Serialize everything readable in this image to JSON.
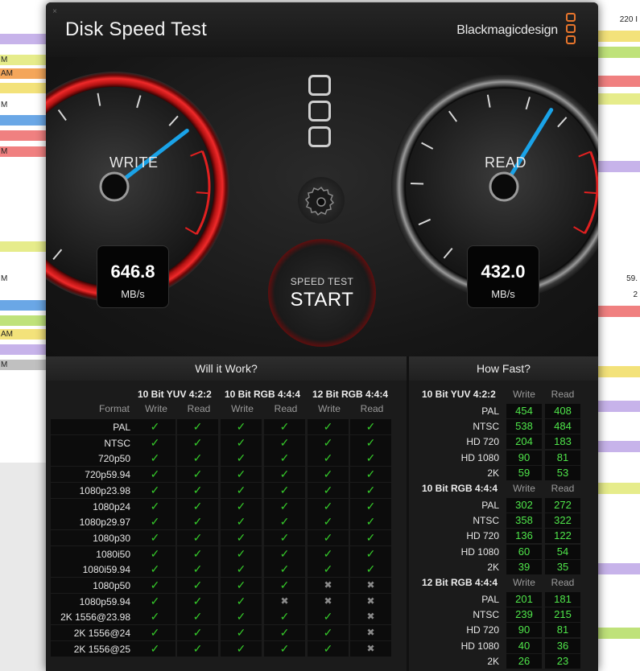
{
  "window": {
    "title": "Disk Speed Test",
    "brand": "Blackmagicdesign",
    "close_glyph": "×"
  },
  "background": {
    "left_fragments": [
      "M",
      "AM",
      "M",
      "M",
      "M",
      "AM",
      "M"
    ],
    "right_fragments": [
      "220 I",
      "59.",
      "2"
    ]
  },
  "gauges": {
    "write": {
      "label": "WRITE",
      "value": "646.8",
      "unit": "MB/s",
      "needle_fraction": 0.74
    },
    "read": {
      "label": "READ",
      "value": "432.0",
      "unit": "MB/s",
      "needle_fraction": 0.66
    }
  },
  "start_button": {
    "sub": "SPEED TEST",
    "main": "START"
  },
  "icons": {
    "settings": "gear-icon",
    "stack": "drive-stack-icon",
    "brand_logo": "blackmagic-logo-icon"
  },
  "colors": {
    "accent_red": "#d41b1b",
    "needle_blue": "#1aa3e8",
    "ok_green": "#35c92a",
    "value_green": "#4fe64a",
    "brand_orange": "#e8752c"
  },
  "will_it_work": {
    "header": "Will it Work?",
    "format_label": "Format",
    "groups": [
      "10 Bit YUV 4:2:2",
      "10 Bit RGB 4:4:4",
      "12 Bit RGB 4:4:4"
    ],
    "col_write": "Write",
    "col_read": "Read",
    "rows": [
      {
        "format": "PAL",
        "cells": [
          1,
          1,
          1,
          1,
          1,
          1
        ]
      },
      {
        "format": "NTSC",
        "cells": [
          1,
          1,
          1,
          1,
          1,
          1
        ]
      },
      {
        "format": "720p50",
        "cells": [
          1,
          1,
          1,
          1,
          1,
          1
        ]
      },
      {
        "format": "720p59.94",
        "cells": [
          1,
          1,
          1,
          1,
          1,
          1
        ]
      },
      {
        "format": "1080p23.98",
        "cells": [
          1,
          1,
          1,
          1,
          1,
          1
        ]
      },
      {
        "format": "1080p24",
        "cells": [
          1,
          1,
          1,
          1,
          1,
          1
        ]
      },
      {
        "format": "1080p29.97",
        "cells": [
          1,
          1,
          1,
          1,
          1,
          1
        ]
      },
      {
        "format": "1080p30",
        "cells": [
          1,
          1,
          1,
          1,
          1,
          1
        ]
      },
      {
        "format": "1080i50",
        "cells": [
          1,
          1,
          1,
          1,
          1,
          1
        ]
      },
      {
        "format": "1080i59.94",
        "cells": [
          1,
          1,
          1,
          1,
          1,
          1
        ]
      },
      {
        "format": "1080p50",
        "cells": [
          1,
          1,
          1,
          1,
          0,
          0
        ]
      },
      {
        "format": "1080p59.94",
        "cells": [
          1,
          1,
          1,
          0,
          0,
          0
        ]
      },
      {
        "format": "2K 1556@23.98",
        "cells": [
          1,
          1,
          1,
          1,
          1,
          0
        ]
      },
      {
        "format": "2K 1556@24",
        "cells": [
          1,
          1,
          1,
          1,
          1,
          0
        ]
      },
      {
        "format": "2K 1556@25",
        "cells": [
          1,
          1,
          1,
          1,
          1,
          0
        ]
      }
    ]
  },
  "how_fast": {
    "header": "How Fast?",
    "col_write": "Write",
    "col_read": "Read",
    "groups": [
      {
        "title": "10 Bit YUV 4:2:2",
        "rows": [
          {
            "label": "PAL",
            "write": "454",
            "read": "408"
          },
          {
            "label": "NTSC",
            "write": "538",
            "read": "484"
          },
          {
            "label": "HD 720",
            "write": "204",
            "read": "183"
          },
          {
            "label": "HD 1080",
            "write": "90",
            "read": "81"
          },
          {
            "label": "2K",
            "write": "59",
            "read": "53"
          }
        ]
      },
      {
        "title": "10 Bit RGB 4:4:4",
        "rows": [
          {
            "label": "PAL",
            "write": "302",
            "read": "272"
          },
          {
            "label": "NTSC",
            "write": "358",
            "read": "322"
          },
          {
            "label": "HD 720",
            "write": "136",
            "read": "122"
          },
          {
            "label": "HD 1080",
            "write": "60",
            "read": "54"
          },
          {
            "label": "2K",
            "write": "39",
            "read": "35"
          }
        ]
      },
      {
        "title": "12 Bit RGB 4:4:4",
        "rows": [
          {
            "label": "PAL",
            "write": "201",
            "read": "181"
          },
          {
            "label": "NTSC",
            "write": "239",
            "read": "215"
          },
          {
            "label": "HD 720",
            "write": "90",
            "read": "81"
          },
          {
            "label": "HD 1080",
            "write": "40",
            "read": "36"
          },
          {
            "label": "2K",
            "write": "26",
            "read": "23"
          }
        ]
      }
    ]
  }
}
